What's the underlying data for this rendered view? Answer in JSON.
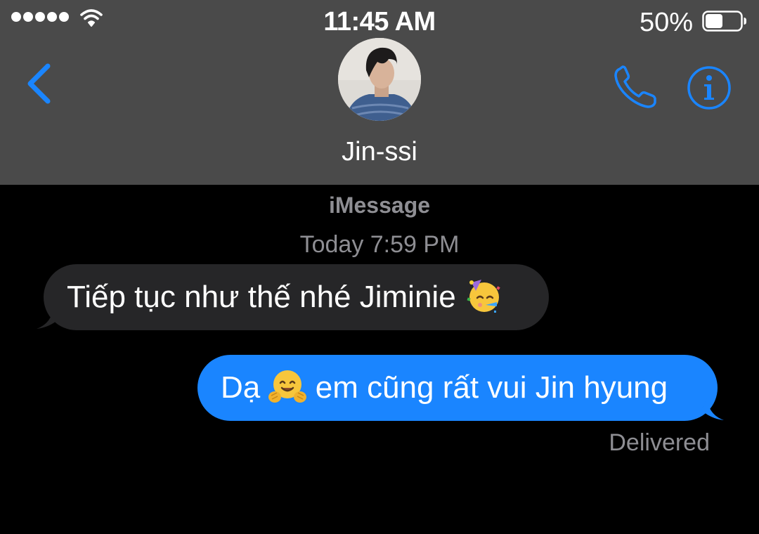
{
  "status_bar": {
    "time": "11:45 AM",
    "battery_percent": "50%",
    "battery_level": 0.5,
    "signal_bars": 5,
    "icons": [
      "signal-dots-icon",
      "wifi-icon",
      "battery-icon"
    ]
  },
  "nav": {
    "contact_name": "Jin-ssi",
    "icons": [
      "back-chevron-icon",
      "phone-icon",
      "info-icon"
    ]
  },
  "conversation": {
    "service": "iMessage",
    "timestamp": "Today 7:59 PM",
    "messages": [
      {
        "direction": "incoming",
        "text": "Tiếp tục như thế nhé Jiminie",
        "emoji": "partying-face-icon"
      },
      {
        "direction": "outgoing",
        "text_before": "Dạ",
        "emoji": "hugging-face-icon",
        "text_after": "em cũng rất vui Jin hyung"
      }
    ],
    "receipt": "Delivered"
  },
  "colors": {
    "header_bg": "#4a4a4a",
    "background": "#000000",
    "accent": "#1a85ff",
    "incoming_bubble": "#262628",
    "outgoing_bubble": "#1a85ff",
    "secondary_text": "#8e8e93"
  }
}
